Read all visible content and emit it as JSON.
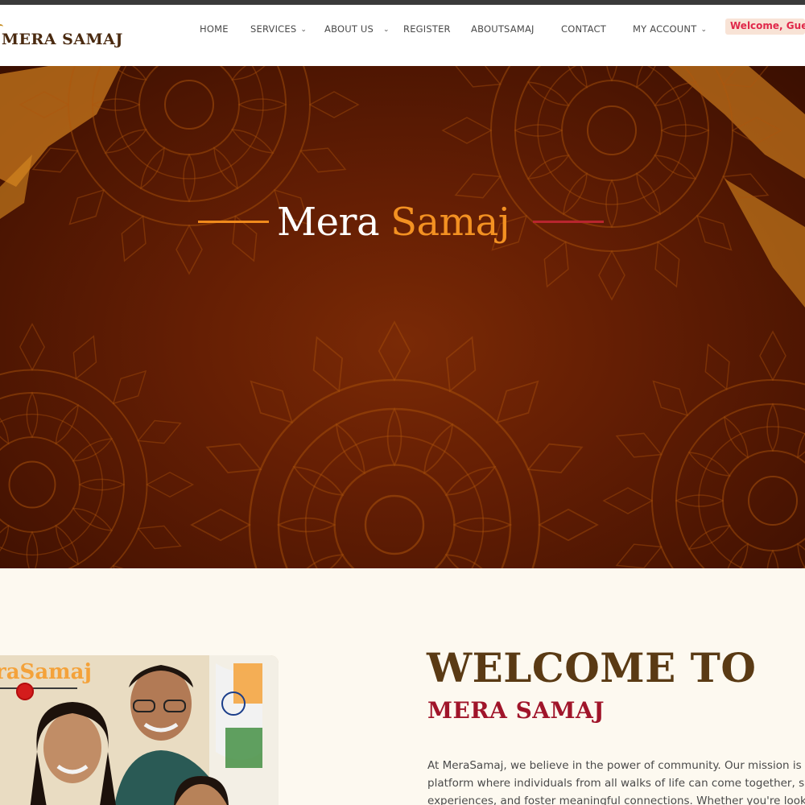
{
  "header": {
    "logo_text": "MERA SAMAJ",
    "nav": [
      {
        "label": "HOME",
        "has_dropdown": false
      },
      {
        "label": "SERVICES",
        "has_dropdown": true
      },
      {
        "label": "ABOUT US",
        "has_dropdown": true
      },
      {
        "label": "REGISTER",
        "has_dropdown": false
      },
      {
        "label": "ABOUTSAMAJ",
        "has_dropdown": false
      },
      {
        "label": "CONTACT",
        "has_dropdown": false
      },
      {
        "label": "MY ACCOUNT",
        "has_dropdown": true
      }
    ],
    "welcome_badge": "Welcome, Guest"
  },
  "hero": {
    "title_part1": "Mera",
    "title_part2": "Samaj",
    "line_left_color": "#f08a1c",
    "line_right_color": "#b8252e"
  },
  "about": {
    "photo_brand": "raSamaj",
    "title": "WELCOME TO",
    "subtitle": "MERA SAMAJ",
    "body_lines": [
      "At MeraSamaj, we believe in the power of community. Our mission is to",
      "platform where individuals from all walks of life can come together, sh",
      "experiences, and foster meaningful connections. Whether you're looki"
    ]
  },
  "colors": {
    "brand_brown": "#4a2a10",
    "accent_orange": "#f39122",
    "accent_red": "#a0152a",
    "hero_bg": "#661f04"
  }
}
